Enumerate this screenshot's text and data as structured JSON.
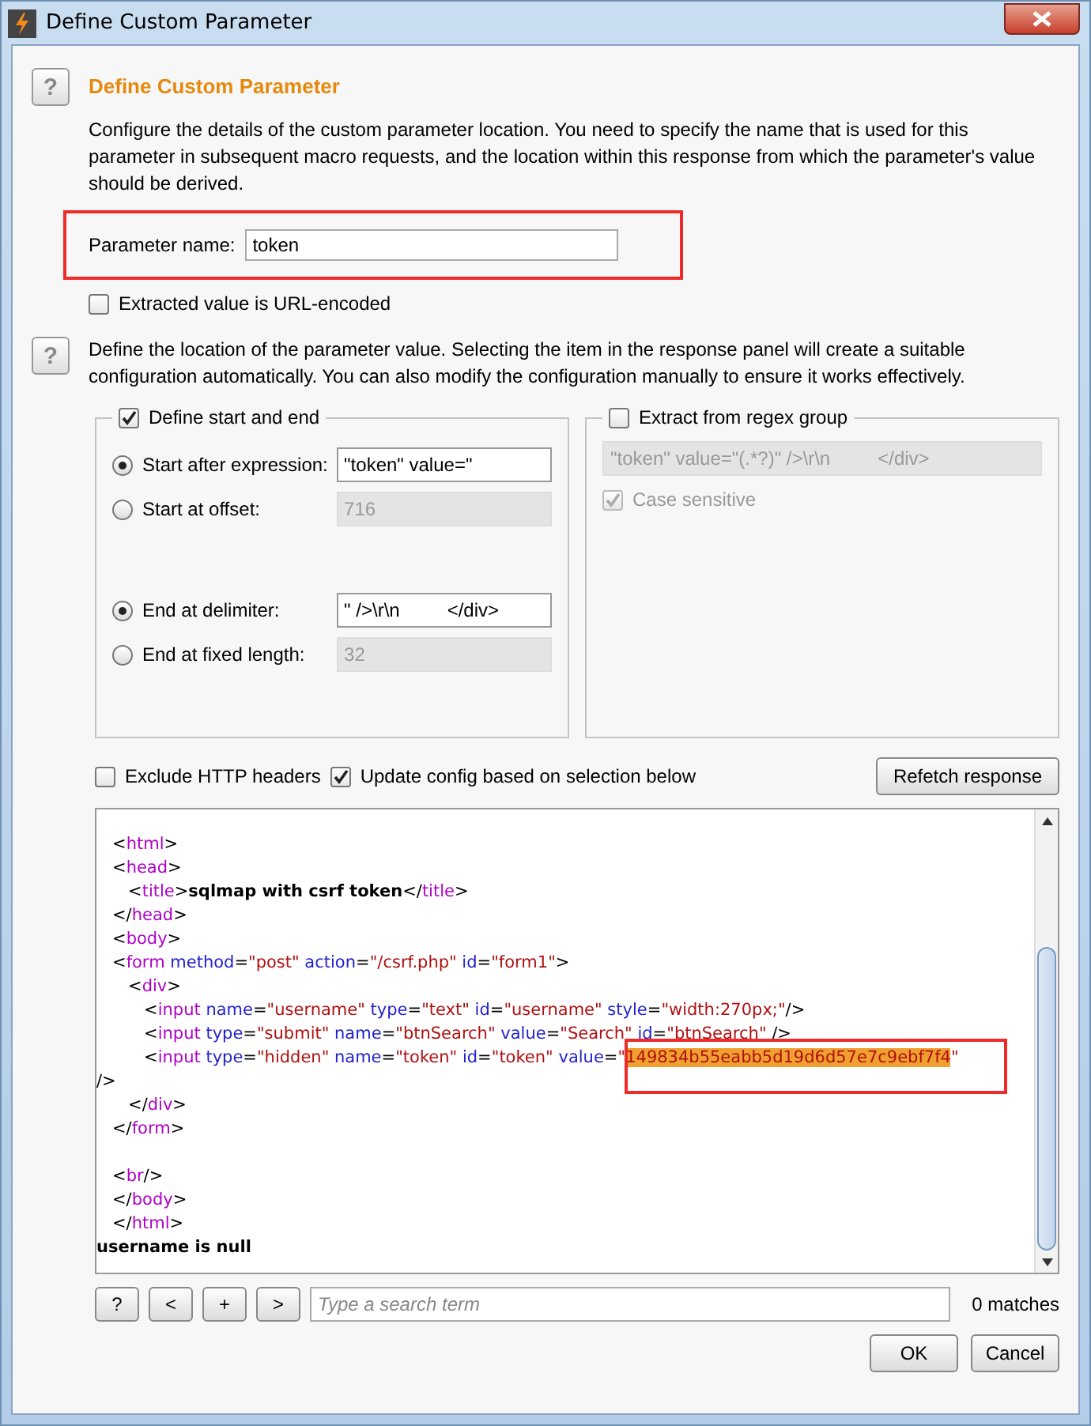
{
  "window": {
    "title": "Define Custom Parameter"
  },
  "heading": "Define Custom Parameter",
  "intro": "Configure the details of the custom parameter location. You need to specify the name that is used for this parameter in subsequent macro requests, and the location within this response from which the parameter's value should be derived.",
  "parameter_name": {
    "label": "Parameter name:",
    "value": "token"
  },
  "url_encoded": {
    "label": "Extracted value is URL-encoded",
    "checked": false
  },
  "location_help": "Define the location of the parameter value. Selecting the item in the response panel will create a suitable configuration automatically. You can also modify the configuration manually to ensure it works effectively.",
  "start_end": {
    "label": "Define start and end",
    "checked": true,
    "options": [
      {
        "label": "Start after expression:",
        "selected": true,
        "value": "\"token\" value=\"",
        "disabled": false
      },
      {
        "label": "Start at offset:",
        "selected": false,
        "value": "716",
        "disabled": true
      },
      {
        "label": "End at delimiter:",
        "selected": true,
        "value": "\" />\\r\\n         </div>",
        "disabled": false
      },
      {
        "label": "End at fixed length:",
        "selected": false,
        "value": "32",
        "disabled": true
      }
    ]
  },
  "regex": {
    "label": "Extract from regex group",
    "checked": false,
    "value": "\"token\" value=\"(.*?)\" />\\r\\n         </div>",
    "disabled": true,
    "case_sensitive": {
      "label": "Case sensitive",
      "checked": true,
      "disabled": true
    }
  },
  "exclude_headers": {
    "label": "Exclude HTTP headers",
    "checked": false
  },
  "update_config": {
    "label": "Update config based on selection below",
    "checked": true
  },
  "refetch_button": "Refetch response",
  "response": [
    {
      "lines": [
        [
          {
            "kind": "punct",
            "text": "   <"
          },
          {
            "kind": "tag",
            "text": "html"
          },
          {
            "kind": "punct",
            "text": ">"
          }
        ],
        [
          {
            "kind": "punct",
            "text": "   <"
          },
          {
            "kind": "tag",
            "text": "head"
          },
          {
            "kind": "punct",
            "text": ">"
          }
        ],
        [
          {
            "kind": "punct",
            "text": "      <"
          },
          {
            "kind": "tag",
            "text": "title"
          },
          {
            "kind": "punct",
            "text": ">"
          },
          {
            "kind": "bold",
            "text": "sqlmap with csrf token"
          },
          {
            "kind": "punct",
            "text": "</"
          },
          {
            "kind": "tag",
            "text": "title"
          },
          {
            "kind": "punct",
            "text": ">"
          }
        ],
        [
          {
            "kind": "punct",
            "text": "   </"
          },
          {
            "kind": "tag",
            "text": "head"
          },
          {
            "kind": "punct",
            "text": ">"
          }
        ],
        [
          {
            "kind": "punct",
            "text": "   <"
          },
          {
            "kind": "tag",
            "text": "body"
          },
          {
            "kind": "punct",
            "text": ">"
          }
        ],
        [
          {
            "kind": "punct",
            "text": "   <"
          },
          {
            "kind": "tag",
            "text": "form"
          },
          {
            "kind": "attr",
            "text": " method"
          },
          {
            "kind": "punct",
            "text": "="
          },
          {
            "kind": "value",
            "text": "\"post\""
          },
          {
            "kind": "attr",
            "text": " action"
          },
          {
            "kind": "punct",
            "text": "="
          },
          {
            "kind": "value",
            "text": "\"/csrf.php\""
          },
          {
            "kind": "attr",
            "text": " id"
          },
          {
            "kind": "punct",
            "text": "="
          },
          {
            "kind": "value",
            "text": "\"form1\""
          },
          {
            "kind": "punct",
            "text": ">"
          }
        ],
        [
          {
            "kind": "punct",
            "text": "      <"
          },
          {
            "kind": "tag",
            "text": "div"
          },
          {
            "kind": "punct",
            "text": ">"
          }
        ],
        [
          {
            "kind": "punct",
            "text": "         <"
          },
          {
            "kind": "tag",
            "text": "input"
          },
          {
            "kind": "attr",
            "text": " name"
          },
          {
            "kind": "punct",
            "text": "="
          },
          {
            "kind": "value",
            "text": "\"username\""
          },
          {
            "kind": "attr",
            "text": " type"
          },
          {
            "kind": "punct",
            "text": "="
          },
          {
            "kind": "value",
            "text": "\"text\""
          },
          {
            "kind": "attr",
            "text": " id"
          },
          {
            "kind": "punct",
            "text": "="
          },
          {
            "kind": "value",
            "text": "\"username\""
          },
          {
            "kind": "attr",
            "text": " style"
          },
          {
            "kind": "punct",
            "text": "="
          },
          {
            "kind": "value",
            "text": "\"width:270px;\""
          },
          {
            "kind": "punct",
            "text": "/>"
          }
        ],
        [
          {
            "kind": "punct",
            "text": "         <"
          },
          {
            "kind": "tag",
            "text": "input"
          },
          {
            "kind": "attr",
            "text": " type"
          },
          {
            "kind": "punct",
            "text": "="
          },
          {
            "kind": "value",
            "text": "\"submit\""
          },
          {
            "kind": "attr",
            "text": " name"
          },
          {
            "kind": "punct",
            "text": "="
          },
          {
            "kind": "value",
            "text": "\"btnSearch\""
          },
          {
            "kind": "attr",
            "text": " value"
          },
          {
            "kind": "punct",
            "text": "="
          },
          {
            "kind": "value",
            "text": "\"Search\""
          },
          {
            "kind": "attr",
            "text": " id"
          },
          {
            "kind": "punct",
            "text": "="
          },
          {
            "kind": "value",
            "text": "\"btnSearch\""
          },
          {
            "kind": "punct",
            "text": " />"
          }
        ],
        [
          {
            "kind": "punct",
            "text": "         <"
          },
          {
            "kind": "tag",
            "text": "input"
          },
          {
            "kind": "attr",
            "text": " type"
          },
          {
            "kind": "punct",
            "text": "="
          },
          {
            "kind": "value",
            "text": "\"hidden\""
          },
          {
            "kind": "attr",
            "text": " name"
          },
          {
            "kind": "punct",
            "text": "="
          },
          {
            "kind": "value",
            "text": "\"token\""
          },
          {
            "kind": "attr",
            "text": " id"
          },
          {
            "kind": "punct",
            "text": "="
          },
          {
            "kind": "value",
            "text": "\"token\""
          },
          {
            "kind": "attr",
            "text": " value"
          },
          {
            "kind": "punct",
            "text": "="
          },
          {
            "kind": "value",
            "text": "\""
          },
          {
            "kind": "selected",
            "text": "149834b55eabb5d19d6d57e7c9ebf7f4"
          },
          {
            "kind": "value",
            "text": "\""
          }
        ],
        [
          {
            "kind": "punct",
            "text": "/>"
          }
        ],
        [
          {
            "kind": "punct",
            "text": "      </"
          },
          {
            "kind": "tag",
            "text": "div"
          },
          {
            "kind": "punct",
            "text": ">"
          }
        ],
        [
          {
            "kind": "punct",
            "text": "   </"
          },
          {
            "kind": "tag",
            "text": "form"
          },
          {
            "kind": "punct",
            "text": ">"
          }
        ]
      ]
    },
    {
      "lines": [
        [
          {
            "kind": "punct",
            "text": "   <"
          },
          {
            "kind": "tag",
            "text": "br"
          },
          {
            "kind": "punct",
            "text": "/>"
          }
        ],
        [
          {
            "kind": "punct",
            "text": "   </"
          },
          {
            "kind": "tag",
            "text": "body"
          },
          {
            "kind": "punct",
            "text": ">"
          }
        ],
        [
          {
            "kind": "punct",
            "text": "   </"
          },
          {
            "kind": "tag",
            "text": "html"
          },
          {
            "kind": "punct",
            "text": ">"
          }
        ],
        [
          {
            "kind": "bold",
            "text": "username is null"
          }
        ]
      ]
    }
  ],
  "search": {
    "buttons": [
      "?",
      "<",
      "+",
      ">"
    ],
    "placeholder": "Type a search term",
    "matches": "0 matches"
  },
  "buttons": [
    "OK",
    "Cancel"
  ]
}
